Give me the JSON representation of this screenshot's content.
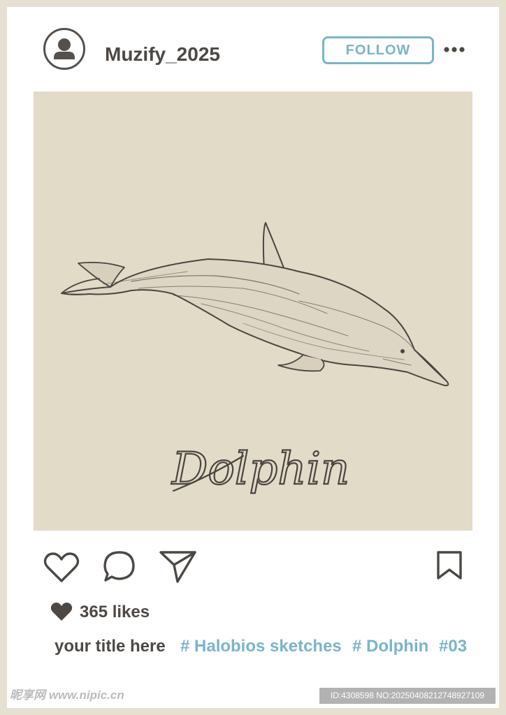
{
  "header": {
    "avatar_icon": "user-avatar-icon",
    "username": "Muzify_2025",
    "follow_label": "FOLLOW",
    "more_icon": "more-horizontal-icon"
  },
  "post": {
    "image_subject": "dolphin-sketch",
    "script_title": "Dolphin",
    "background_color": "#e2dbc8"
  },
  "actions": {
    "like_icon": "heart-outline-icon",
    "comment_icon": "comment-bubble-icon",
    "share_icon": "send-paper-plane-icon",
    "save_icon": "bookmark-icon"
  },
  "stats": {
    "likes_icon": "heart-filled-icon",
    "likes_text": "365 likes"
  },
  "caption": {
    "title": "your title here",
    "tags": [
      "# Halobios sketches",
      "# Dolphin",
      "#03"
    ]
  },
  "watermark": {
    "site": "昵享网 www.nipic.cn",
    "id_text": "ID:4308598 NO:20250408212748927109"
  },
  "colors": {
    "accent": "#7ab4cc",
    "text": "#4d4844",
    "frame": "#e6e0d3"
  }
}
